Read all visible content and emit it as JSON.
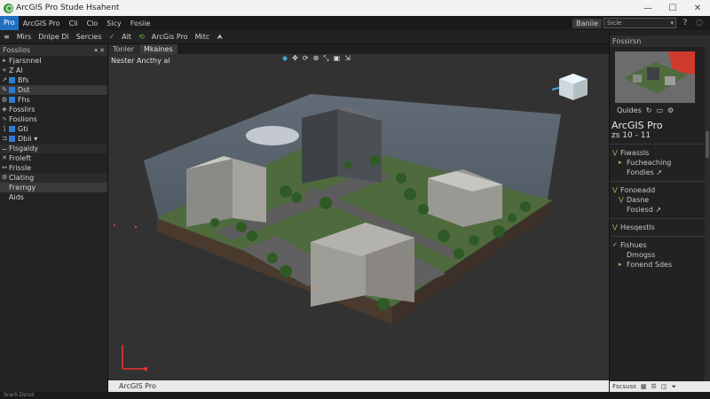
{
  "window": {
    "title": "ArcGIS Pro Stude Hsahent",
    "minimize": "—",
    "maximize": "☐",
    "close": "✕"
  },
  "menubar": {
    "pro_label": "Pro",
    "items": [
      "ArcGIS Pro",
      "Cli",
      "Clo",
      "Sicy",
      "Fosiie"
    ],
    "search_label": "Baniie",
    "search_value": "Sicle"
  },
  "toolbar": {
    "items": [
      "Mirs",
      "Dnlpe Di",
      "Sercies",
      "Alt",
      "ArcGis Pro",
      "Mitc"
    ]
  },
  "left_panel": {
    "header": "Fossilos",
    "rows": [
      {
        "icon": "▸",
        "label": "Fjarsnnel"
      },
      {
        "icon": "",
        "label": "Z Al"
      },
      {
        "icon": "",
        "label": "Bfs",
        "swatch": true
      },
      {
        "icon": "",
        "label": "Dst",
        "swatch": true
      },
      {
        "icon": "",
        "label": "Fhs",
        "swatch": true
      },
      {
        "icon": "",
        "label": "Fosslirs"
      },
      {
        "icon": "",
        "label": "Foslions"
      },
      {
        "icon": "",
        "label": "Gti",
        "swatch": true
      },
      {
        "icon": "",
        "label": "Dbii ▾",
        "swatch": true
      }
    ],
    "section1": {
      "header": "Flsgaldy",
      "rows": [
        "Froleft",
        "Frissle"
      ]
    },
    "section2": {
      "header": "Clating",
      "rows": [
        "Frarngy",
        "Aids"
      ]
    }
  },
  "view_tabs": [
    "Tonler",
    "Mkaines"
  ],
  "scene": {
    "label": "Nester Ancthy al"
  },
  "status": {
    "text": "ArcGIS Pro"
  },
  "bottom": {
    "text": "Srarli Dsnol"
  },
  "right_panel": {
    "header": "Fossirsn",
    "thumb_caption": "Quides",
    "title": "ArcGIS Pro",
    "meta": "zs 10 - 11",
    "rows": [
      {
        "label": "Fiwassls",
        "caret": "⋁"
      },
      {
        "label": "Fucheaching",
        "caret": "▸",
        "sub": true
      },
      {
        "label": "Fondies ↗",
        "sub": true
      },
      {
        "label": "Fonoeadd",
        "caret": "⋁"
      },
      {
        "label": "Dasne",
        "caret": "⋁",
        "sub": true
      },
      {
        "label": "Fosiesd ↗",
        "sub": true
      },
      {
        "label": "Hesqestls",
        "caret": "⋁"
      },
      {
        "label": "Fishues",
        "caret": "⋁"
      },
      {
        "label": "Dmogss",
        "sub": true
      },
      {
        "label": "Fonend Sdes",
        "caret": "▸",
        "sub": true
      }
    ],
    "footer": "Fscsuss"
  }
}
